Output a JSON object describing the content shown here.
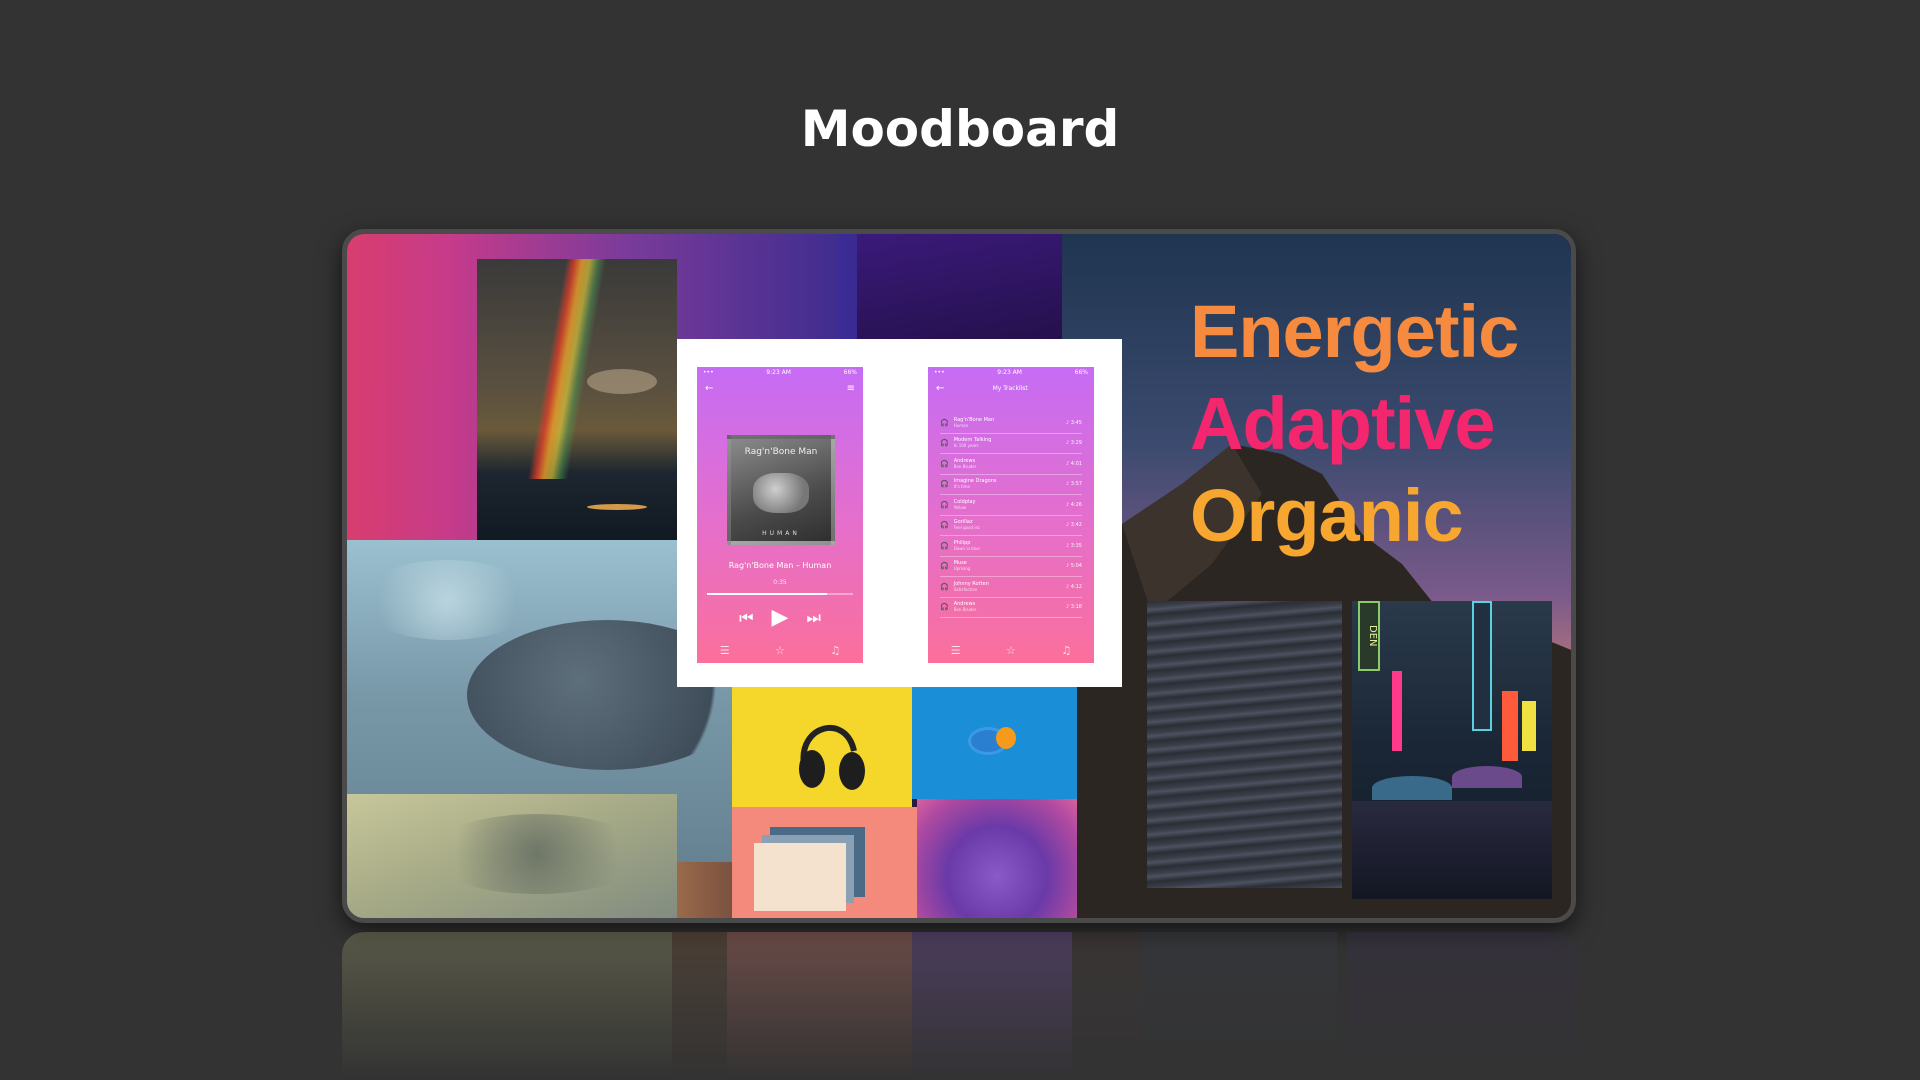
{
  "page": {
    "title": "Moodboard"
  },
  "keywords": {
    "items": [
      {
        "text": "Energetic",
        "color": "#f68a3f"
      },
      {
        "text": "Adaptive",
        "color": "#f3266e"
      },
      {
        "text": "Organic",
        "color": "#f7a630"
      }
    ]
  },
  "player_screen": {
    "status_time": "9:23 AM",
    "status_battery": "66%",
    "album_title": "Rag'n'Bone Man",
    "album_subtitle": "HUMAN",
    "song_title": "Rag'n'Bone Man – Human",
    "song_time": "0:35",
    "progress": 0.82,
    "prev_icon": "⏮",
    "play_icon": "▶",
    "next_icon": "⏭"
  },
  "tracklist_screen": {
    "status_time": "9:23 AM",
    "status_battery": "66%",
    "title": "My Tracklist",
    "tracks": [
      {
        "title": "Rag'n'Bone Man",
        "artist": "Human",
        "duration": "3:45"
      },
      {
        "title": "Modern Talking",
        "artist": "In 100 years",
        "duration": "3:29"
      },
      {
        "title": "Andrews",
        "artist": "Ben Bruder",
        "duration": "4:01"
      },
      {
        "title": "Imagine Dragons",
        "artist": "It's time",
        "duration": "3:57"
      },
      {
        "title": "Coldplay",
        "artist": "Yellow",
        "duration": "4:26"
      },
      {
        "title": "Gorillaz",
        "artist": "Feel good inc",
        "duration": "3:42"
      },
      {
        "title": "Philipp",
        "artist": "Dawn in blue",
        "duration": "3:35"
      },
      {
        "title": "Muse",
        "artist": "Uprising",
        "duration": "5:04"
      },
      {
        "title": "Johnny Rotten",
        "artist": "Satisfaction",
        "duration": "4:12"
      },
      {
        "title": "Andrews",
        "artist": "Ben Bruder",
        "duration": "3:18"
      }
    ]
  },
  "sign_texts": {
    "den": "DEN"
  }
}
